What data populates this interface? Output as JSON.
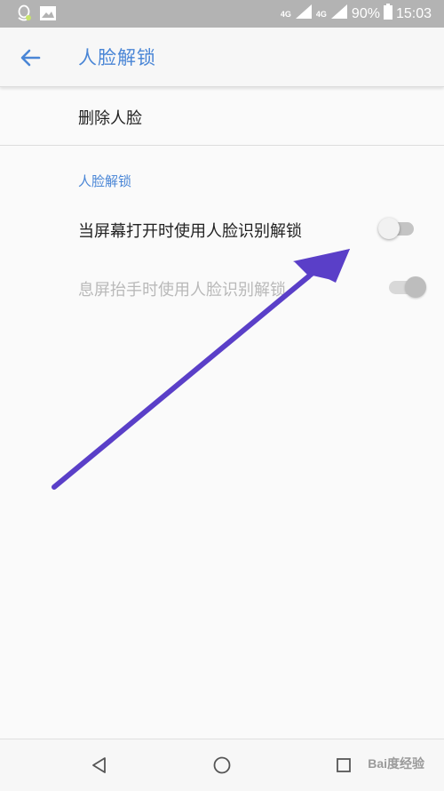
{
  "status_bar": {
    "network_1": "4G",
    "network_2": "4G",
    "battery": "90%",
    "time": "15:03"
  },
  "app_bar": {
    "title": "人脸解锁"
  },
  "delete_face": {
    "label": "删除人脸"
  },
  "section": {
    "header": "人脸解锁"
  },
  "prefs": [
    {
      "label": "当屏幕打开时使用人脸识别解锁",
      "enabled": true,
      "on": false
    },
    {
      "label": "息屏抬手时使用人脸识别解锁",
      "enabled": false,
      "on": true
    }
  ],
  "watermark": {
    "text": "Bai度经验"
  },
  "colors": {
    "accent": "#4a86d6",
    "annotation_arrow": "#5a3fc8",
    "status_bar": "#b3b3b3"
  },
  "icons": {
    "back": "arrow-left-icon",
    "nav_back": "triangle-back-icon",
    "nav_home": "circle-home-icon",
    "nav_recents": "square-recents-icon"
  }
}
